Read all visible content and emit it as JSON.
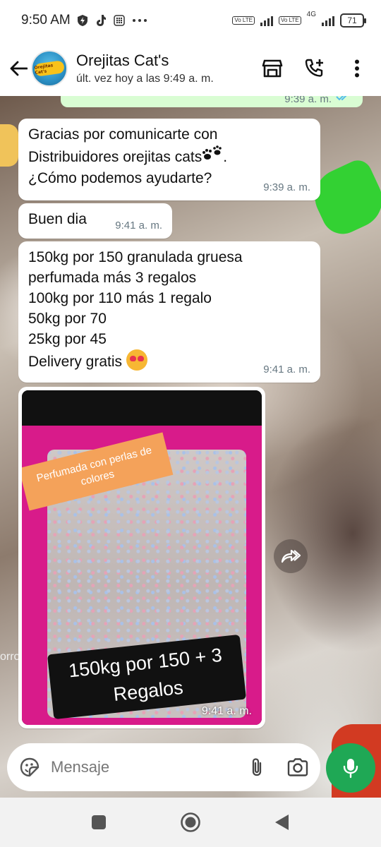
{
  "status_bar": {
    "time": "9:50 AM",
    "left_icons": [
      "shield-bolt-icon",
      "tiktok-icon",
      "grid-app-icon",
      "more-dots-icon"
    ],
    "volte_1": "Vo LTE",
    "volte_2": "Vo LTE",
    "network": "4G",
    "battery": "71"
  },
  "header": {
    "contact_name": "Orejitas Cat's",
    "last_seen": "últ. vez hoy a las 9:49 a. m.",
    "avatar_text": "Orejitas Cat's",
    "actions": [
      "shop-icon",
      "add-call-icon",
      "more-vert-icon"
    ]
  },
  "chat": {
    "top_strip_time": "9:39 a. m.",
    "messages": [
      {
        "lines": [
          "Gracias por comunicarte con",
          "Distribuidores orejitas cats",
          "¿Cómo podemos ayudarte?"
        ],
        "emoji": "paw-prints-icon",
        "time": "9:39 a. m."
      },
      {
        "text": "Buen dia",
        "time": "9:41 a. m."
      },
      {
        "lines": [
          "150kg  por 150 granulada gruesa",
          "perfumada más 3 regalos",
          "100kg por 110 más 1 regalo",
          "50kg por 70",
          "25kg por 45",
          "Delivery gratis"
        ],
        "emoji": "heart-eyes-cat-icon",
        "time": "9:41 a. m."
      }
    ],
    "image_message": {
      "orange_label": "Perfumada con perlas de colores",
      "black_label_line1": "150kg  por 150 + 3",
      "black_label_line2": "Regalos",
      "time": "9:41 a. m."
    },
    "wallpaper_text": "orro"
  },
  "input": {
    "placeholder": "Mensaje"
  },
  "colors": {
    "outgoing_bubble": "#d9fdd3",
    "incoming_bubble": "#ffffff",
    "mic_button": "#1fa855",
    "timestamp": "#667781"
  }
}
